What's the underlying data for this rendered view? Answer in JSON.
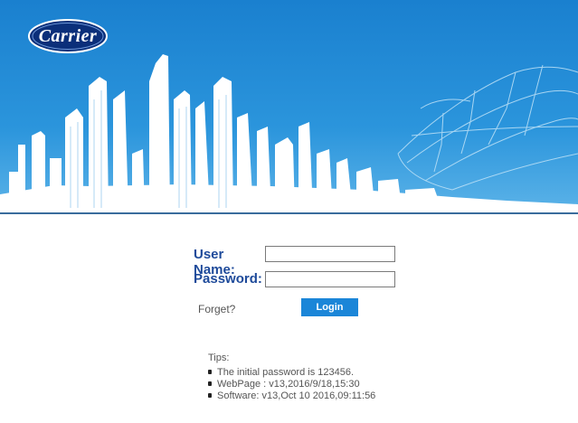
{
  "header": {
    "logo_text": "Carrier"
  },
  "login": {
    "username_label": "User Name:",
    "username_value": "",
    "password_label": "Password:",
    "password_value": "",
    "forget_label": "Forget?",
    "login_button_label": "Login"
  },
  "tips": {
    "title": "Tips:",
    "items": [
      "The initial password is 123456.",
      "WebPage : v13,2016/9/18,15:30",
      "Software: v13,Oct 10 2016,09:11:56"
    ]
  },
  "colors": {
    "banner_blue": "#1f8ad6",
    "label_blue": "#1e4a9a",
    "button_blue": "#1b86d8"
  }
}
